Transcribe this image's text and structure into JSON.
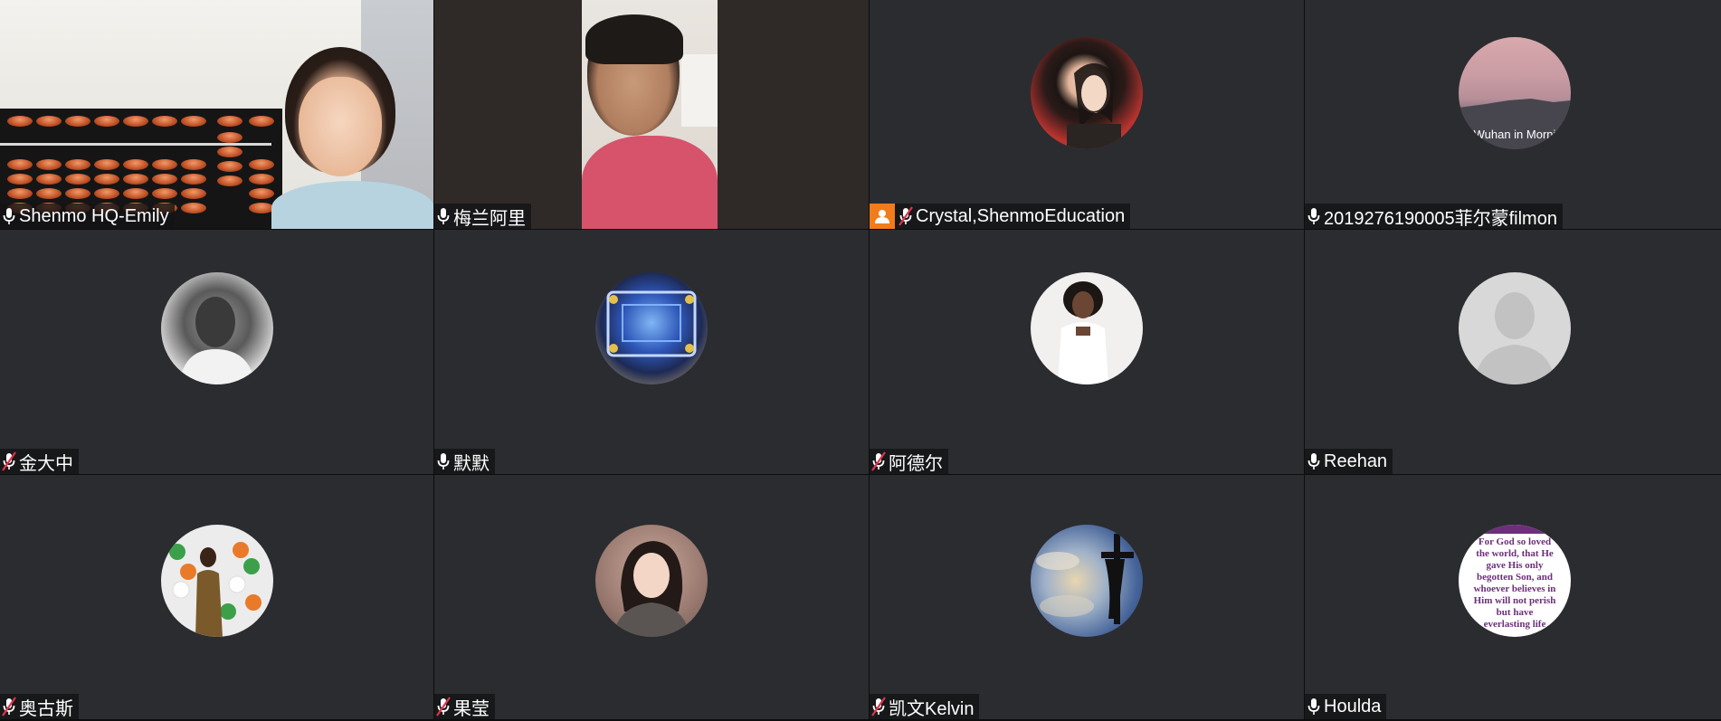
{
  "participants": [
    {
      "name": "Shenmo HQ-Emily",
      "mic": "on",
      "video": true,
      "active_speaker": true
    },
    {
      "name": "梅兰阿里",
      "mic": "on",
      "video": true
    },
    {
      "name": "Crystal,ShenmoEducation",
      "mic": "muted",
      "host": true,
      "avatar": "photo-woman"
    },
    {
      "name": "2019276190005菲尔蒙filmon",
      "mic": "on",
      "avatar": "photo-sunset",
      "avatar_caption": "Wuhan in Morni"
    },
    {
      "name": "金大中",
      "mic": "muted",
      "avatar": "photo-man-bw"
    },
    {
      "name": "默默",
      "mic": "on",
      "avatar": "photo-circuit-board"
    },
    {
      "name": "阿德尔",
      "mic": "muted",
      "avatar": "photo-woman-white"
    },
    {
      "name": "Reehan",
      "mic": "on",
      "avatar": "default-silhouette"
    },
    {
      "name": "奥古斯",
      "mic": "muted",
      "avatar": "photo-balloons"
    },
    {
      "name": "果莹",
      "mic": "muted",
      "avatar": "photo-woman-portrait"
    },
    {
      "name": "凯文Kelvin",
      "mic": "muted",
      "avatar": "photo-cross-sky"
    },
    {
      "name": "Houlda",
      "mic": "on",
      "avatar": "bible-verse-text",
      "avatar_text": [
        "For God so loved",
        "the world, that He",
        "gave His only",
        "begotten Son, and",
        "whoever believes in",
        "Him will not perish",
        "but have",
        "everlasting life"
      ]
    }
  ],
  "colors": {
    "tile_bg": "#2b2c30",
    "active_border": "#23d959",
    "host_badge": "#f27b1a",
    "muted_slash": "#e0324b"
  }
}
